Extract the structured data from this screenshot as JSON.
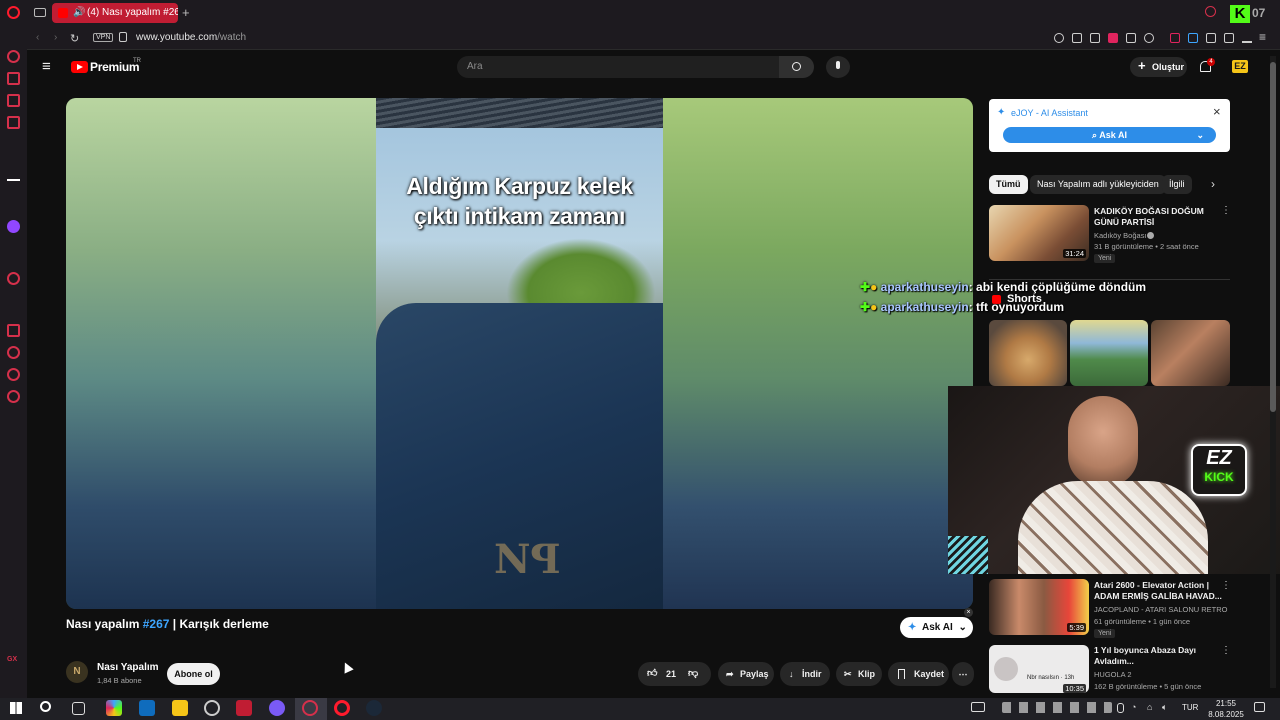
{
  "browser": {
    "tab_title": "(4) Nası yapalım #267",
    "vpn_label": "VPN",
    "url_host": "www.youtube.com",
    "url_path": "/watch"
  },
  "youtube": {
    "logo_text": "Premium",
    "logo_sup": "TR",
    "search_placeholder": "Ara",
    "create_label": "Oluştur",
    "notif_count": "4"
  },
  "video": {
    "caption_line1": "Aldığım Karpuz kelek",
    "caption_line2": "çıktı intikam zamanı",
    "title_prefix": "Nası yapalım",
    "title_tag": "#267",
    "title_suffix": "| Karışık derleme",
    "ask_ai": "Ask AI"
  },
  "channel": {
    "name": "Nası Yapalım",
    "subs": "1,84 B abone",
    "subscribe": "Abone ol"
  },
  "actions": {
    "likes": "21",
    "share": "Paylaş",
    "download": "İndir",
    "clip": "Klip",
    "save": "Kaydet"
  },
  "ejoy": {
    "title": "eJOY - AI Assistant",
    "button": "Ask AI"
  },
  "chips": [
    "Tümü",
    "Nası Yapalım adlı yükleyiciden",
    "İlgili"
  ],
  "recommendations": [
    {
      "title1": "KADIKÖY BOĞASI DOĞUM",
      "title2": "GÜNÜ PARTİSİ",
      "channel": "Kadıköy Boğası",
      "meta": "31 B görüntüleme • 2 saat önce",
      "badge": "Yeni",
      "duration": "31:24"
    },
    {
      "title1": "Atari 2600 - Elevator Action |",
      "title2": "ADAM ERMİŞ GALİBA HAVAD...",
      "channel": "JACOPLAND - ATARI SALONU RETRO KO...",
      "meta": "61 görüntüleme • 1 gün önce",
      "badge": "Yeni",
      "duration": "5:39"
    },
    {
      "title1": "1 Yıl boyunca Abaza Dayı",
      "title2": "Avladım...",
      "channel": "HUGOLA 2",
      "meta": "162 B görüntüleme • 5 gün önce",
      "badge": "",
      "duration": "10:35"
    }
  ],
  "shorts_label": "Shorts",
  "chat": [
    {
      "user": "aparkathuseyin",
      "msg": ": abi kendi çöplüğüme döndüm"
    },
    {
      "user": "aparkathuseyin",
      "msg": ": tft oynuyordum"
    }
  ],
  "stream_logo": {
    "line1": "EZ",
    "line2": "KICK"
  },
  "thumb_text": "Nbr nasılsın · 13h",
  "taskbar": {
    "lang": "TUR",
    "time": "21:55",
    "date": "8.08.2025"
  },
  "colors": {
    "opera_red": "#c01d33",
    "youtube_red": "#ff0000",
    "link_blue": "#3ea6ff",
    "ejoy_blue": "#2d8de8"
  }
}
